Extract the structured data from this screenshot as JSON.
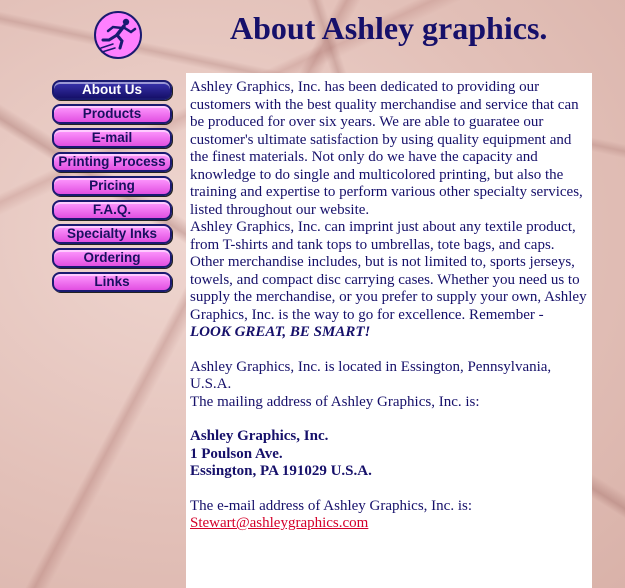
{
  "header": {
    "title": "About Ashley graphics.",
    "logo_icon": "running-figure-logo"
  },
  "nav": {
    "items": [
      {
        "label": "About Us",
        "active": true
      },
      {
        "label": "Products",
        "active": false
      },
      {
        "label": "E-mail",
        "active": false
      },
      {
        "label": "Printing Process",
        "active": false
      },
      {
        "label": "Pricing",
        "active": false
      },
      {
        "label": "F.A.Q.",
        "active": false
      },
      {
        "label": "Specialty Inks",
        "active": false
      },
      {
        "label": "Ordering",
        "active": false
      },
      {
        "label": "Links",
        "active": false
      }
    ]
  },
  "content": {
    "para1": "Ashley Graphics, Inc. has been dedicated to providing our customers with the best quality merchandise and service that can be produced for over six years. We are able to guaratee our customer's ultimate satisfaction by using quality equipment and the finest materials. Not only do we have the capacity and knowledge to do single and multicolored printing, but also the training and expertise to perform various other specialty services, listed throughout our website.",
    "para2": "Ashley Graphics, Inc. can imprint just about any textile product, from T-shirts and tank tops to umbrellas, tote bags, and caps. Other merchandise includes, but is not limited to, sports jerseys, towels, and compact disc carrying cases. Whether you need us to supply the merchandise, or you prefer to supply your own, Ashley Graphics, Inc. is the way to go for excellence. Remember - ",
    "slogan": "LOOK GREAT, BE SMART!",
    "location": "Ashley Graphics, Inc. is located in Essington, Pennsylvania, U.S.A.",
    "mailing_intro": "The mailing address of Ashley Graphics, Inc. is:",
    "address": {
      "name": "Ashley Graphics, Inc.",
      "street": "1 Poulson Ave.",
      "city": "Essington, PA 191029 U.S.A."
    },
    "email_intro": "The e-mail address of Ashley Graphics, Inc. is:",
    "email": "Stewart@ashleygraphics.com"
  },
  "colors": {
    "title": "#16106a",
    "nav_button": "#ff80ff",
    "nav_active": "#16106a",
    "link": "#d4002a",
    "background": "#e3c1b9"
  }
}
